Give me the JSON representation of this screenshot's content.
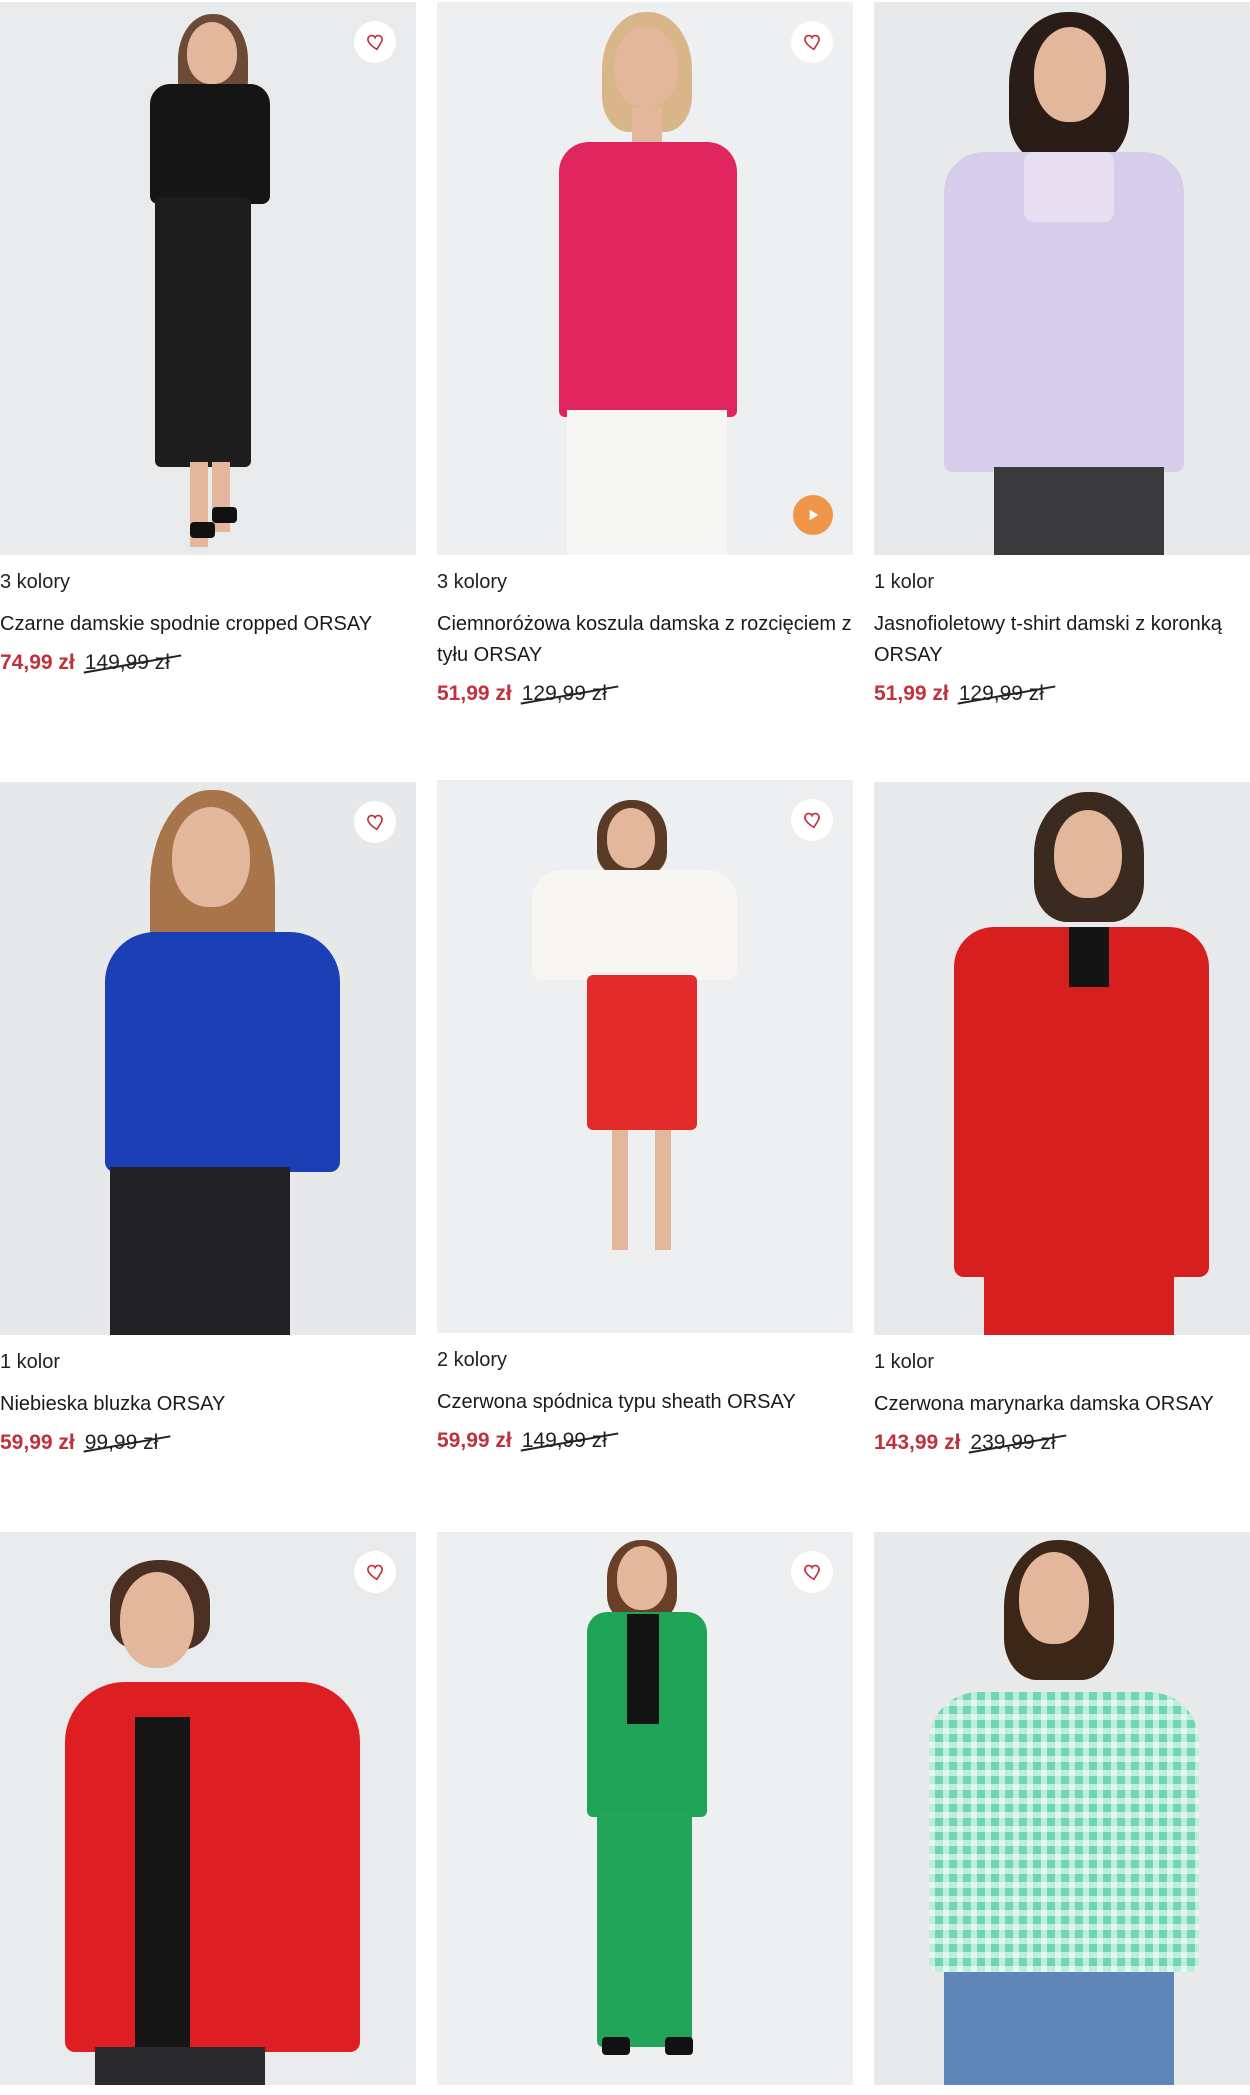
{
  "colors": {
    "price_now": "#c0323b",
    "image_bg": "#ecedef",
    "play_button": "#f0964a",
    "heart_icon": "#c0323b"
  },
  "products": [
    {
      "colors_label": "3 kolory",
      "name": "Czarne damskie spodnie cropped ORSAY",
      "price_now": "74,99 zł",
      "price_old": "149,99 zł",
      "has_video": false,
      "icon": "heart-icon"
    },
    {
      "colors_label": "3 kolory",
      "name": "Ciemnoróżowa koszula damska z rozcięciem z tyłu ORSAY",
      "price_now": "51,99 zł",
      "price_old": "129,99 zł",
      "has_video": true,
      "icon": "heart-icon"
    },
    {
      "colors_label": "1 kolor",
      "name": "Jasnofioletowy t-shirt damski z koronką ORSAY",
      "price_now": "51,99 zł",
      "price_old": "129,99 zł",
      "has_video": false,
      "icon": "heart-icon"
    },
    {
      "colors_label": "1 kolor",
      "name": "Niebieska bluzka ORSAY",
      "price_now": "59,99 zł",
      "price_old": "99,99 zł",
      "has_video": false,
      "icon": "heart-icon"
    },
    {
      "colors_label": "2 kolory",
      "name": "Czerwona spódnica typu sheath ORSAY",
      "price_now": "59,99 zł",
      "price_old": "149,99 zł",
      "has_video": false,
      "icon": "heart-icon"
    },
    {
      "colors_label": "1 kolor",
      "name": "Czerwona marynarka damska ORSAY",
      "price_now": "143,99 zł",
      "price_old": "239,99 zł",
      "has_video": false,
      "icon": "heart-icon"
    },
    {
      "icon": "heart-icon"
    },
    {
      "icon": "heart-icon"
    },
    {
      "icon": "heart-icon"
    }
  ]
}
